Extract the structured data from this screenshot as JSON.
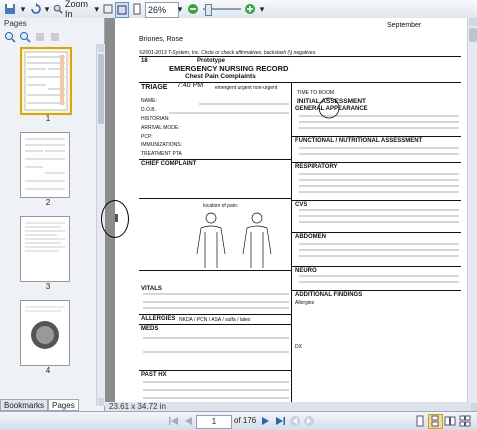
{
  "toolbar": {
    "zoom_in_label": "Zoom In",
    "zoom_value": "26%"
  },
  "sidebar": {
    "title": "Pages",
    "thumbs": [
      {
        "label": "1"
      },
      {
        "label": "2"
      },
      {
        "label": "3"
      },
      {
        "label": "4"
      }
    ],
    "tabs": [
      "Bookmarks",
      "Pages"
    ]
  },
  "document": {
    "month": "September",
    "patient_name": "Briones, Rose",
    "copyright": "©2001-2013 T-System, Inc. Circle or check affirmatives, backslash (\\) negatives.",
    "form_num": "18",
    "prototype": "Prototype",
    "title": "EMERGENCY NURSING RECORD",
    "subtitle": "Chest Pain Complaints",
    "triage_label": "TRIAGE",
    "triage_time": "7:40 PM",
    "triage_levels": "emergent   urgent   non-urgent",
    "time_to_room": "TIME TO ROOM",
    "initial_assessment": "INITIAL ASSESSMENT",
    "fields_left": [
      "NAME:",
      "D.O.B.",
      "HISTORIAN:",
      "ARRIVAL MODE:",
      "PCP:",
      "IMMUNIZATIONS:",
      "TREATMENT PTA"
    ],
    "chief_complaint": "CHIEF COMPLAINT",
    "location_of_pain": "location of pain:",
    "vitals": "VITALS",
    "allergies": "ALLERGIES",
    "allergies_options": "NKDA / PCN / ASA / sulfa / latex",
    "meds": "MEDS",
    "past_hx": "PAST HX",
    "right_sections": [
      "GENERAL APPEARANCE",
      "FUNCTIONAL / NUTRITIONAL ASSESSMENT",
      "RESPIRATORY",
      "CVS",
      "ABDOMEN",
      "NEURO",
      "ADDITIONAL FINDINGS"
    ],
    "allergies_right": "Allergies",
    "dx_label": "DX"
  },
  "status_bar": {
    "page_size": "23.61 x 34.72 in"
  },
  "navigation": {
    "current_page": "1",
    "total_pages": "of 176"
  }
}
